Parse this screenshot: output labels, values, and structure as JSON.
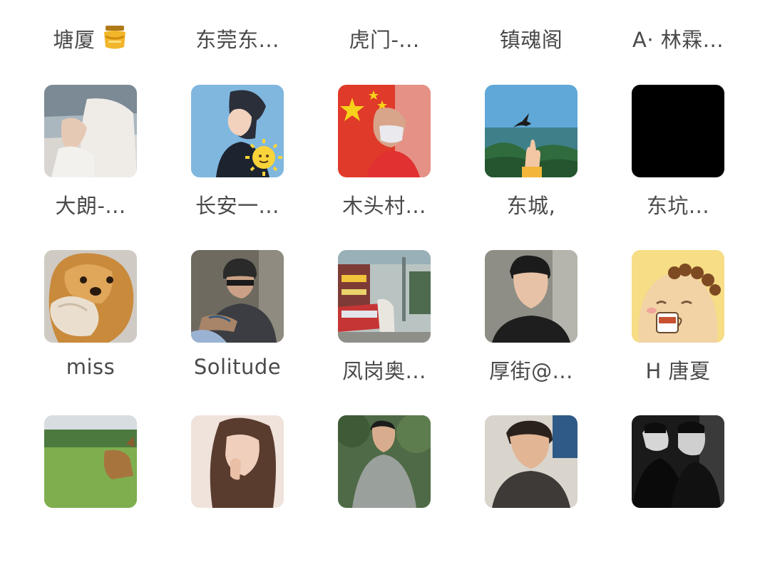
{
  "members": [
    {
      "name": "塘厦",
      "avatar_icon": "partial-avatar"
    },
    {
      "name": "东莞东...",
      "avatar_icon": "partial-avatar"
    },
    {
      "name": "虎门-...",
      "avatar_icon": "partial-avatar"
    },
    {
      "name": "镇魂阁",
      "avatar_icon": "partial-avatar"
    },
    {
      "name": "A· 林霖...",
      "avatar_icon": "partial-avatar"
    },
    {
      "name": "大朗-...",
      "avatar_icon": "hand-photo-avatar"
    },
    {
      "name": "长安一...",
      "avatar_icon": "anime-boy-sun-avatar"
    },
    {
      "name": "木头村...",
      "avatar_icon": "flag-selfie-avatar"
    },
    {
      "name": "东城,",
      "avatar_icon": "bird-hand-avatar"
    },
    {
      "name": "东坑...",
      "avatar_icon": "black-avatar"
    },
    {
      "name": "miss",
      "avatar_icon": "golden-dog-avatar"
    },
    {
      "name": "Solitude",
      "avatar_icon": "cap-man-avatar"
    },
    {
      "name": "凤岗奥...",
      "avatar_icon": "street-tram-avatar"
    },
    {
      "name": "厚街@...",
      "avatar_icon": "young-man-avatar"
    },
    {
      "name": "H 唐夏",
      "avatar_icon": "cartoon-coffee-avatar"
    },
    {
      "name": "",
      "avatar_icon": "deer-park-avatar"
    },
    {
      "name": "",
      "avatar_icon": "girl-closeup-avatar"
    },
    {
      "name": "",
      "avatar_icon": "man-trees-avatar"
    },
    {
      "name": "",
      "avatar_icon": "man-selfie-avatar"
    },
    {
      "name": "",
      "avatar_icon": "bw-group-avatar"
    }
  ],
  "emoji_icon": "honey-pot-icon"
}
